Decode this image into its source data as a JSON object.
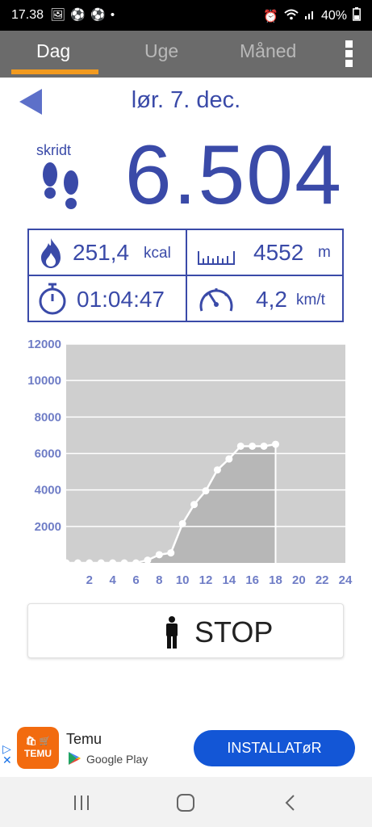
{
  "status_bar": {
    "time": "17.38",
    "notification_icons": [
      "alarm-clock-icon",
      "soccer-ball-icon",
      "soccer-ball-icon",
      "dot-icon"
    ],
    "battery": "40%"
  },
  "tabs": [
    {
      "label": "Dag",
      "active": true
    },
    {
      "label": "Uge",
      "active": false
    },
    {
      "label": "Måned",
      "active": false
    }
  ],
  "date": "lør. 7. dec.",
  "steps": {
    "label": "skridt",
    "value": "6.504"
  },
  "stats": {
    "calories": {
      "value": "251,4",
      "unit": "kcal"
    },
    "distance": {
      "value": "4552",
      "unit": "m"
    },
    "duration": {
      "value": "01:04:47"
    },
    "speed": {
      "value": "4,2",
      "unit": "km/t"
    }
  },
  "chart_data": {
    "type": "area",
    "x": [
      0,
      1,
      2,
      3,
      4,
      5,
      6,
      7,
      8,
      9,
      10,
      11,
      12,
      13,
      14,
      15,
      16,
      17,
      18
    ],
    "values": [
      0,
      0,
      0,
      0,
      0,
      0,
      0,
      150,
      450,
      550,
      2150,
      3200,
      3950,
      5100,
      5700,
      6400,
      6400,
      6400,
      6504
    ],
    "x_ticks": [
      "2",
      "4",
      "6",
      "8",
      "10",
      "12",
      "14",
      "16",
      "18",
      "20",
      "22",
      "24"
    ],
    "y_ticks": [
      "2000",
      "4000",
      "6000",
      "8000",
      "10000",
      "12000"
    ],
    "xlim": [
      0,
      24
    ],
    "ylim": [
      0,
      12000
    ],
    "grid": true,
    "colors": {
      "plot_bg": "#cfcfcf",
      "fill": "#b7b7b7",
      "line": "#ffffff",
      "tick_text": "#6f7dc6"
    }
  },
  "stop_button": {
    "label": "STOP"
  },
  "ad": {
    "app_name": "Temu",
    "store": "Google Play",
    "install_label": "INSTALLATøR",
    "logo_text": "TEMU"
  },
  "colors": {
    "accent": "#3a4aa8",
    "tab_bar": "#6b6b6b",
    "tab_indicator": "#f29a1f",
    "ad_button": "#1356d6"
  }
}
